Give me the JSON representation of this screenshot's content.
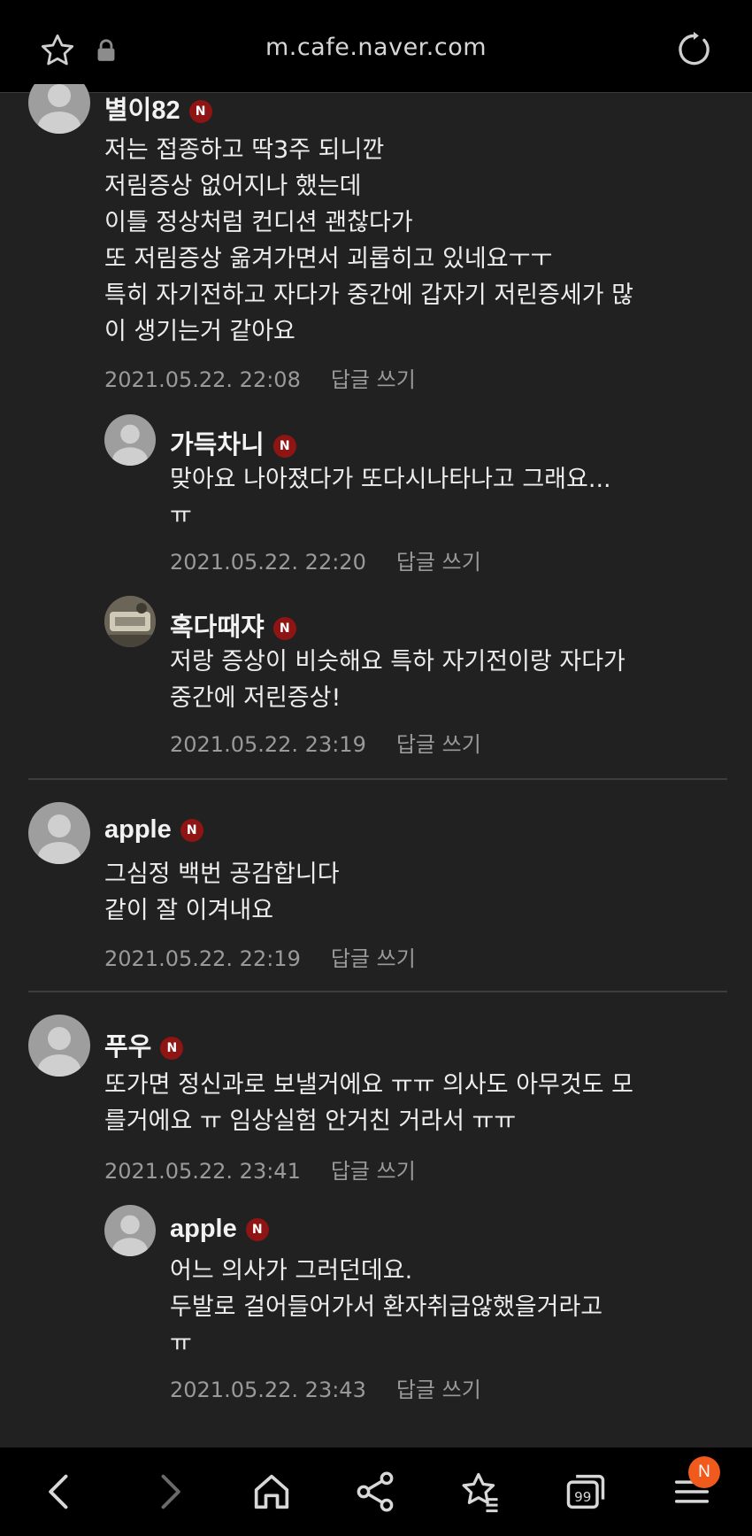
{
  "browser": {
    "url": "m.cafe.naver.com",
    "icons": [
      "star-icon",
      "lock-icon",
      "reload-icon"
    ]
  },
  "comments": [
    {
      "nickname": "별이82",
      "badge": "N",
      "text": "저는 접종하고 딱3주 되니깐\n저림증상 없어지나 했는데\n이틀 정상처럼 컨디션 괜찮다가\n또 저림증상 옮겨가면서 괴롭히고 있네요ㅜㅜ\n특히 자기전하고 자다가 중간에 갑자기 저린증세가 많\n이 생기는거 같아요",
      "date": "2021.05.22. 22:08",
      "reply_label": "답글 쓰기"
    },
    {
      "nickname": "가득차니",
      "badge": "N",
      "text": "맞아요 나아졌다가 또다시나타나고 그래요...\nㅠ",
      "date": "2021.05.22. 22:20",
      "reply_label": "답글 쓰기"
    },
    {
      "nickname": "혹다때쟈",
      "badge": "N",
      "text": "저랑 증상이 비슷해요 특하 자기전이랑 자다가\n중간에 저린증상!",
      "date": "2021.05.22. 23:19",
      "reply_label": "답글 쓰기"
    },
    {
      "nickname": "apple",
      "badge": "N",
      "text": "그심정 백번 공감합니다\n같이 잘 이겨내요",
      "date": "2021.05.22. 22:19",
      "reply_label": "답글 쓰기"
    },
    {
      "nickname": "푸우",
      "badge": "N",
      "text": "또가면 정신과로 보낼거에요 ㅠㅠ 의사도 아무것도 모\n를거에요 ㅠ 임상실험 안거친 거라서 ㅠㅠ",
      "date": "2021.05.22. 23:41",
      "reply_label": "답글 쓰기"
    },
    {
      "nickname": "apple",
      "badge": "N",
      "text": "어느 의사가 그러던데요.\n두발로 걸어들어가서 환자취급않했을거라고\nㅠ",
      "date": "2021.05.22. 23:43",
      "reply_label": "답글 쓰기"
    }
  ],
  "bottom_nav": {
    "icons": [
      "back-icon",
      "forward-icon",
      "home-icon",
      "share-icon",
      "bookmark-icon",
      "tabs-icon",
      "menu-icon"
    ],
    "notification_badge": "N"
  },
  "colors": {
    "background": "#212121",
    "bar": "#000000",
    "badge": "#8f1414",
    "notification": "#f05a1c",
    "meta_text": "#9a9a9a"
  }
}
